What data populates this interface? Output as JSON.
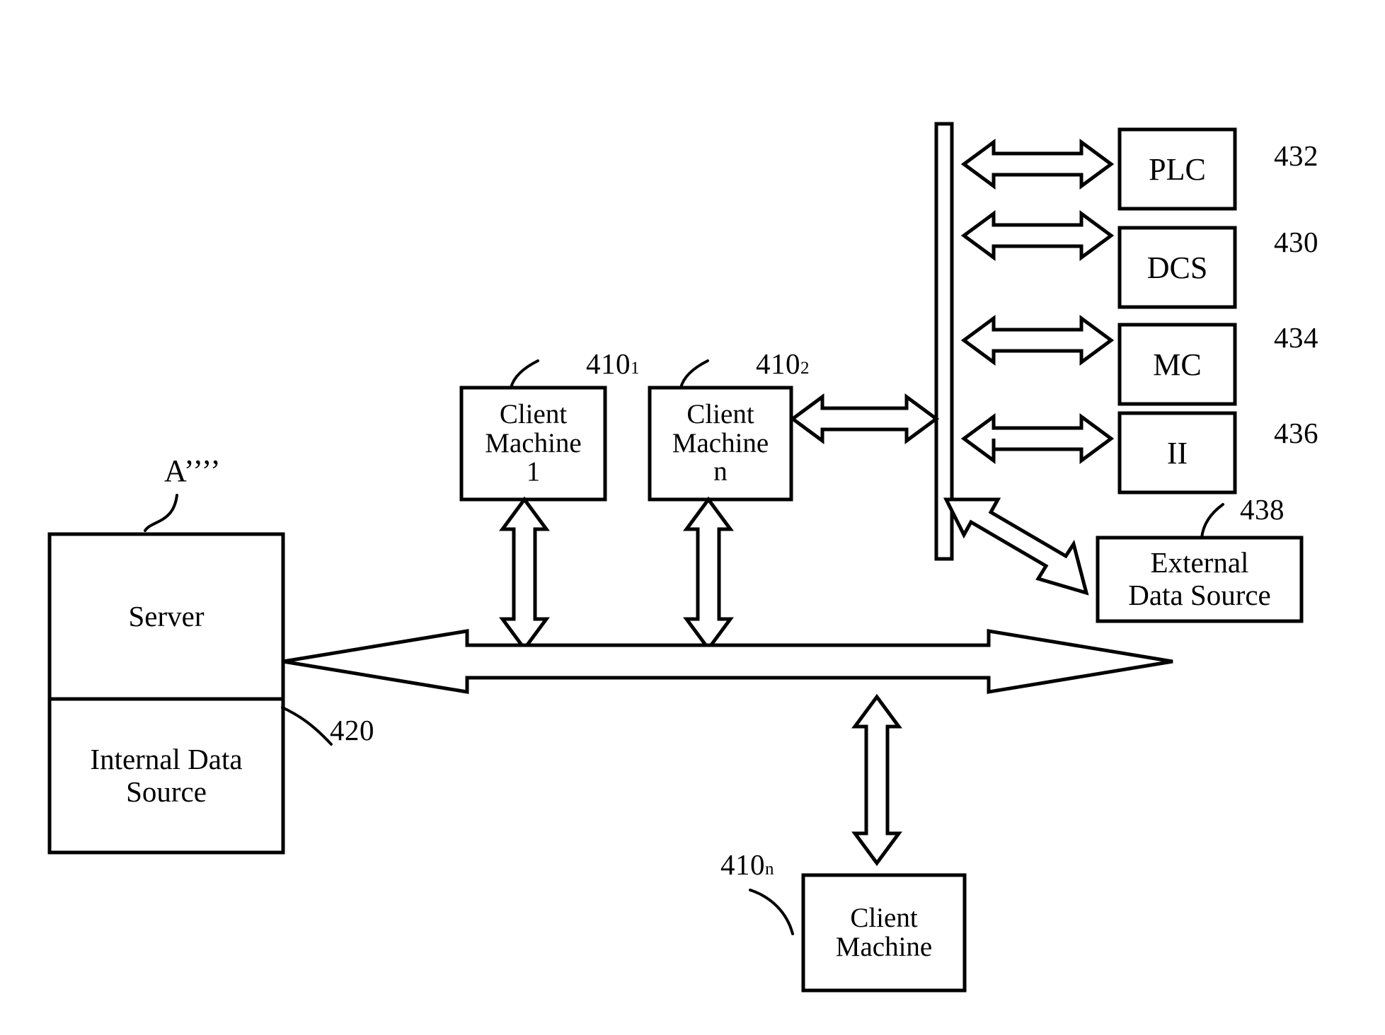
{
  "figure": {
    "type": "patent-block-diagram",
    "tag_label": "A’’’’"
  },
  "server": {
    "title": "Server",
    "internal_data_source": "Internal Data\nSource",
    "internal_data_source_line1": "Internal Data",
    "internal_data_source_line2": "Source",
    "ref": "420"
  },
  "client_machines": [
    {
      "name": "client-machine-1",
      "line1": "Client",
      "line2": "Machine",
      "line3": "1",
      "ref": "410",
      "ref_sub": "1"
    },
    {
      "name": "client-machine-n-top",
      "line1": "Client",
      "line2": "Machine",
      "line3": "n",
      "ref": "410",
      "ref_sub": "2"
    },
    {
      "name": "client-machine-n-bottom",
      "line1": "Client",
      "line2": "Machine",
      "line3": "",
      "ref": "410",
      "ref_sub": "n"
    }
  ],
  "devices": [
    {
      "label": "PLC",
      "ref": "432"
    },
    {
      "label": "DCS",
      "ref": "430"
    },
    {
      "label": "MC",
      "ref": "434"
    },
    {
      "label": "II",
      "ref": "436"
    }
  ],
  "external_data_source": {
    "line1": "External",
    "line2": "Data Source",
    "ref": "438"
  },
  "colors": {
    "stroke": "#000000",
    "fill": "#ffffff",
    "background": "#ffffff"
  }
}
